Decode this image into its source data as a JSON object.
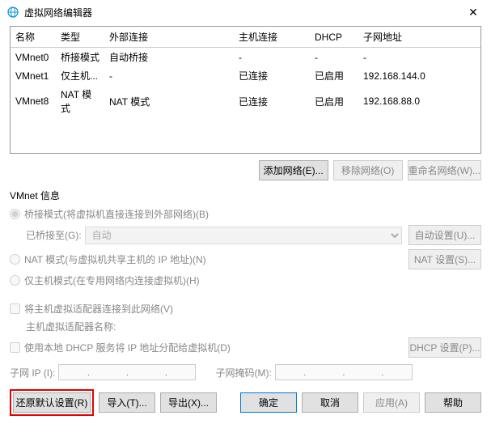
{
  "window": {
    "title": "虚拟网络编辑器"
  },
  "table": {
    "headers": [
      "名称",
      "类型",
      "外部连接",
      "主机连接",
      "DHCP",
      "子网地址"
    ],
    "rows": [
      {
        "name": "VMnet0",
        "type": "桥接模式",
        "ext": "自动桥接",
        "host": "-",
        "dhcp": "-",
        "subnet": "-"
      },
      {
        "name": "VMnet1",
        "type": "仅主机...",
        "ext": "-",
        "host": "已连接",
        "dhcp": "已启用",
        "subnet": "192.168.144.0"
      },
      {
        "name": "VMnet8",
        "type": "NAT 模式",
        "ext": "NAT 模式",
        "host": "已连接",
        "dhcp": "已启用",
        "subnet": "192.168.88.0"
      }
    ]
  },
  "buttons": {
    "add": "添加网络(E)...",
    "remove": "移除网络(O)",
    "rename": "重命名网络(W)...",
    "auto_set": "自动设置(U)...",
    "nat_set": "NAT 设置(S)...",
    "dhcp_set": "DHCP 设置(P)...",
    "restore": "还原默认设置(R)",
    "import": "导入(T)...",
    "export": "导出(X)...",
    "ok": "确定",
    "cancel": "取消",
    "apply": "应用(A)",
    "help": "帮助"
  },
  "info": {
    "group_label": "VMnet 信息",
    "bridge_radio": "桥接模式(将虚拟机直接连接到外部网络)(B)",
    "bridge_to_label": "已桥接至(G):",
    "bridge_to_value": "自动",
    "nat_radio": "NAT 模式(与虚拟机共享主机的 IP 地址)(N)",
    "host_radio": "仅主机模式(在专用网络内连接虚拟机)(H)",
    "host_adapter_check": "将主机虚拟适配器连接到此网络(V)",
    "host_adapter_name_label": "主机虚拟适配器名称:",
    "dhcp_check": "使用本地 DHCP 服务将 IP 地址分配给虚拟机(D)",
    "subnet_ip_label": "子网 IP (I):",
    "subnet_mask_label": "子网掩码(M):"
  }
}
